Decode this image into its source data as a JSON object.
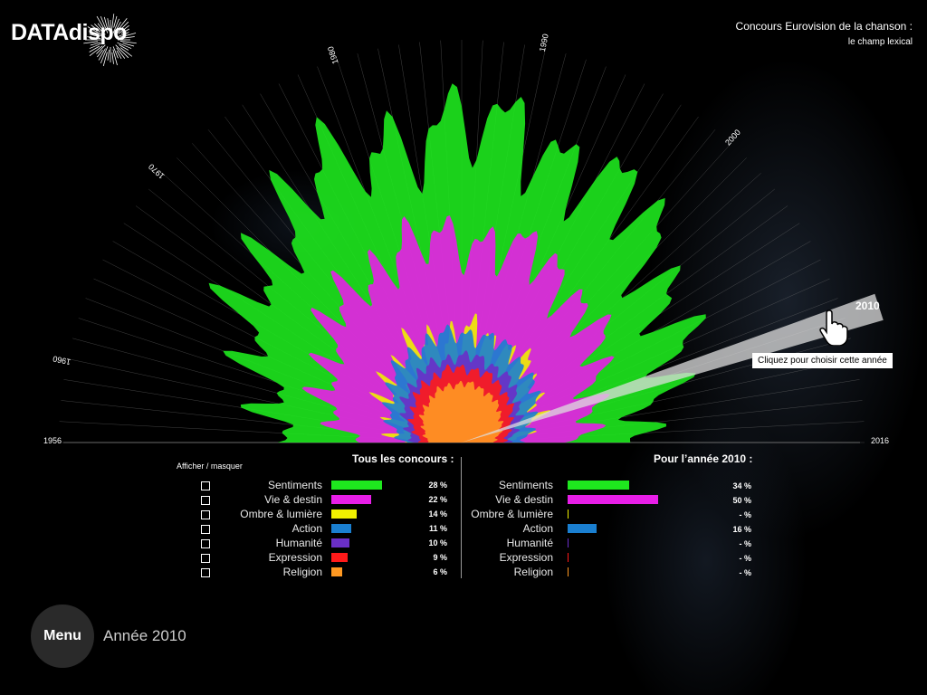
{
  "brand": {
    "logo_text": "DATAdispo"
  },
  "header": {
    "title": "Concours Eurovision de la chanson :",
    "subtitle": "le champ lexical"
  },
  "colors": {
    "sentiments": "#1ee81e",
    "vie_destin": "#e81ee8",
    "ombre_lumiere": "#f0f000",
    "action": "#1a7fd0",
    "humanite": "#6a2fc8",
    "expression": "#ff1a1a",
    "religion": "#ff9922"
  },
  "chart_data": {
    "type": "radial-area",
    "year_range": [
      1956,
      2016
    ],
    "year_labels": [
      "1956",
      "1960",
      "1970",
      "1980",
      "1990",
      "2000",
      "2010",
      "2016"
    ],
    "selected_year": "2010",
    "tooltip": "Cliquez pour choisir cette année",
    "series": [
      {
        "name": "Sentiments",
        "color": "#1ee81e",
        "share": 28
      },
      {
        "name": "Vie & destin",
        "color": "#e81ee8",
        "share": 22
      },
      {
        "name": "Ombre & lumière",
        "color": "#f0f000",
        "share": 14
      },
      {
        "name": "Action",
        "color": "#1a7fd0",
        "share": 11
      },
      {
        "name": "Humanité",
        "color": "#6a2fc8",
        "share": 10
      },
      {
        "name": "Expression",
        "color": "#ff1a1a",
        "share": 9
      },
      {
        "name": "Religion",
        "color": "#ff9922",
        "share": 6
      }
    ]
  },
  "legend": {
    "toggle_title": "Afficher / masquer",
    "all_title": "Tous les concours :",
    "year_title": "Pour l’année 2010  :",
    "rows": [
      {
        "label": "Sentiments",
        "color": "#1ee81e",
        "all_value": 28,
        "all_pct": "28 %",
        "year_value": 34,
        "year_pct": "34 %"
      },
      {
        "label": "Vie & destin",
        "color": "#e81ee8",
        "all_value": 22,
        "all_pct": "22 %",
        "year_value": 50,
        "year_pct": "50 %"
      },
      {
        "label": "Ombre & lumière",
        "color": "#f0f000",
        "all_value": 14,
        "all_pct": "14 %",
        "year_value": 0,
        "year_pct": "- %"
      },
      {
        "label": "Action",
        "color": "#1a7fd0",
        "all_value": 11,
        "all_pct": "11 %",
        "year_value": 16,
        "year_pct": "16 %"
      },
      {
        "label": "Humanité",
        "color": "#6a2fc8",
        "all_value": 10,
        "all_pct": "10 %",
        "year_value": 0,
        "year_pct": "- %"
      },
      {
        "label": "Expression",
        "color": "#ff1a1a",
        "all_value": 9,
        "all_pct": "9 %",
        "year_value": 0,
        "year_pct": "- %"
      },
      {
        "label": "Religion",
        "color": "#ff9922",
        "all_value": 6,
        "all_pct": "6 %",
        "year_value": 0,
        "year_pct": "- %"
      }
    ]
  },
  "footer": {
    "menu_label": "Menu",
    "year_readout": "Année 2010"
  }
}
